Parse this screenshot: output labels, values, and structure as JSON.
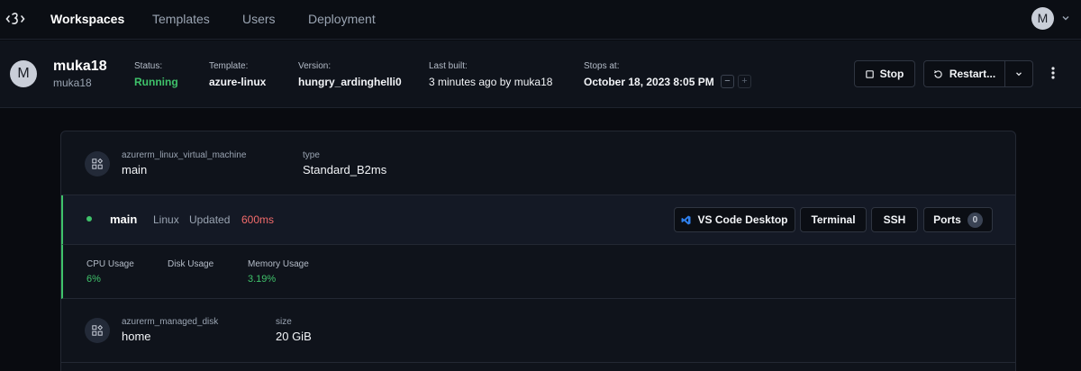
{
  "nav": {
    "items": [
      {
        "label": "Workspaces",
        "active": true
      },
      {
        "label": "Templates",
        "active": false
      },
      {
        "label": "Users",
        "active": false
      },
      {
        "label": "Deployment",
        "active": false
      }
    ],
    "avatar_letter": "M"
  },
  "workspace": {
    "avatar_letter": "M",
    "name": "muka18",
    "owner": "muka18",
    "stats": {
      "status": {
        "label": "Status:",
        "value": "Running"
      },
      "template": {
        "label": "Template:",
        "value": "azure-linux"
      },
      "version": {
        "label": "Version:",
        "value": "hungry_ardinghelli0"
      },
      "last_built": {
        "label": "Last built:",
        "value": "3 minutes ago by muka18"
      },
      "stops_at": {
        "label": "Stops at:",
        "value": "October 18, 2023 8:05 PM"
      }
    },
    "decrease_symbol": "−",
    "increase_symbol": "+",
    "actions": {
      "stop": "Stop",
      "restart": "Restart..."
    }
  },
  "resources": {
    "vm": {
      "kind": "azurerm_linux_virtual_machine",
      "name": "main",
      "attr_label": "type",
      "attr_value": "Standard_B2ms"
    },
    "agent": {
      "name": "main",
      "os": "Linux",
      "updated_label": "Updated",
      "latency": "600ms",
      "buttons": {
        "vscode": "VS Code Desktop",
        "terminal": "Terminal",
        "ssh": "SSH",
        "ports": "Ports",
        "ports_count": "0"
      },
      "metrics": [
        {
          "label": "CPU Usage",
          "value": "6%"
        },
        {
          "label": "Disk Usage",
          "value": ""
        },
        {
          "label": "Memory Usage",
          "value": "3.19%"
        }
      ]
    },
    "disk": {
      "kind": "azurerm_managed_disk",
      "name": "home",
      "attr_label": "size",
      "attr_value": "20 GiB"
    }
  },
  "colors": {
    "success": "#3fc26a",
    "latency_warning": "#f26b6b",
    "vscode_blue": "#2f80ed"
  }
}
